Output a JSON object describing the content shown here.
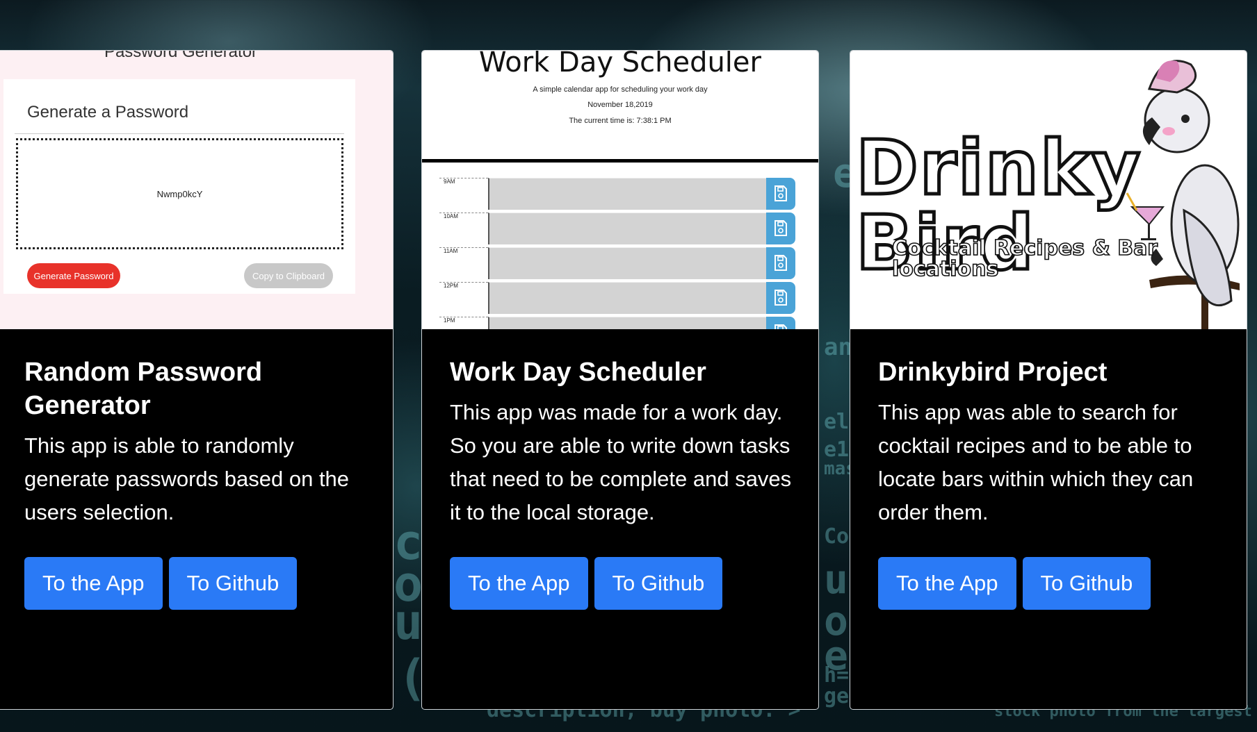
{
  "background": {
    "glyphs": [
      "b",
      "s",
      "ebs",
      "ank",
      "el1",
      "e11",
      "mas",
      "Co",
      "ub",
      "om",
      "ep",
      "h=",
      "ge,",
      "cr",
      "os",
      "ul",
      "( [",
      "description, buy photo. >",
      "stock photo from the largest library of"
    ]
  },
  "cards": [
    {
      "title": "Random Password Generator",
      "description": "This app is able to randomly generate passwords based on the users selection.",
      "app_button": "To the App",
      "github_button": "To Github",
      "thumbnail": {
        "page_title": "Password Generator",
        "heading": "Generate a Password",
        "password": "Nwmp0kcY",
        "generate_button": "Generate Password",
        "copy_button": "Copy to Clipboard"
      }
    },
    {
      "title": "Work Day Scheduler",
      "description": "This app was made for a work day. So you are able to write down tasks that need to be complete and saves it to the local storage.",
      "app_button": "To the App",
      "github_button": "To Github",
      "thumbnail": {
        "page_title": "Work Day Scheduler",
        "subtitle": "A simple calendar app for scheduling your work day",
        "date": "November 18,2019",
        "time": "The current time is: 7:38:1 PM",
        "hours": [
          "9AM",
          "10AM",
          "11AM",
          "12PM",
          "1PM"
        ]
      }
    },
    {
      "title": "Drinkybird Project",
      "description": "This app was able to search for cocktail recipes and to be able to locate bars within which they can order them.",
      "app_button": "To the App",
      "github_button": "To Github",
      "thumbnail": {
        "logo_text": "Drinky Bird",
        "tagline": "Cocktail Recipes & Bar locations"
      }
    }
  ]
}
